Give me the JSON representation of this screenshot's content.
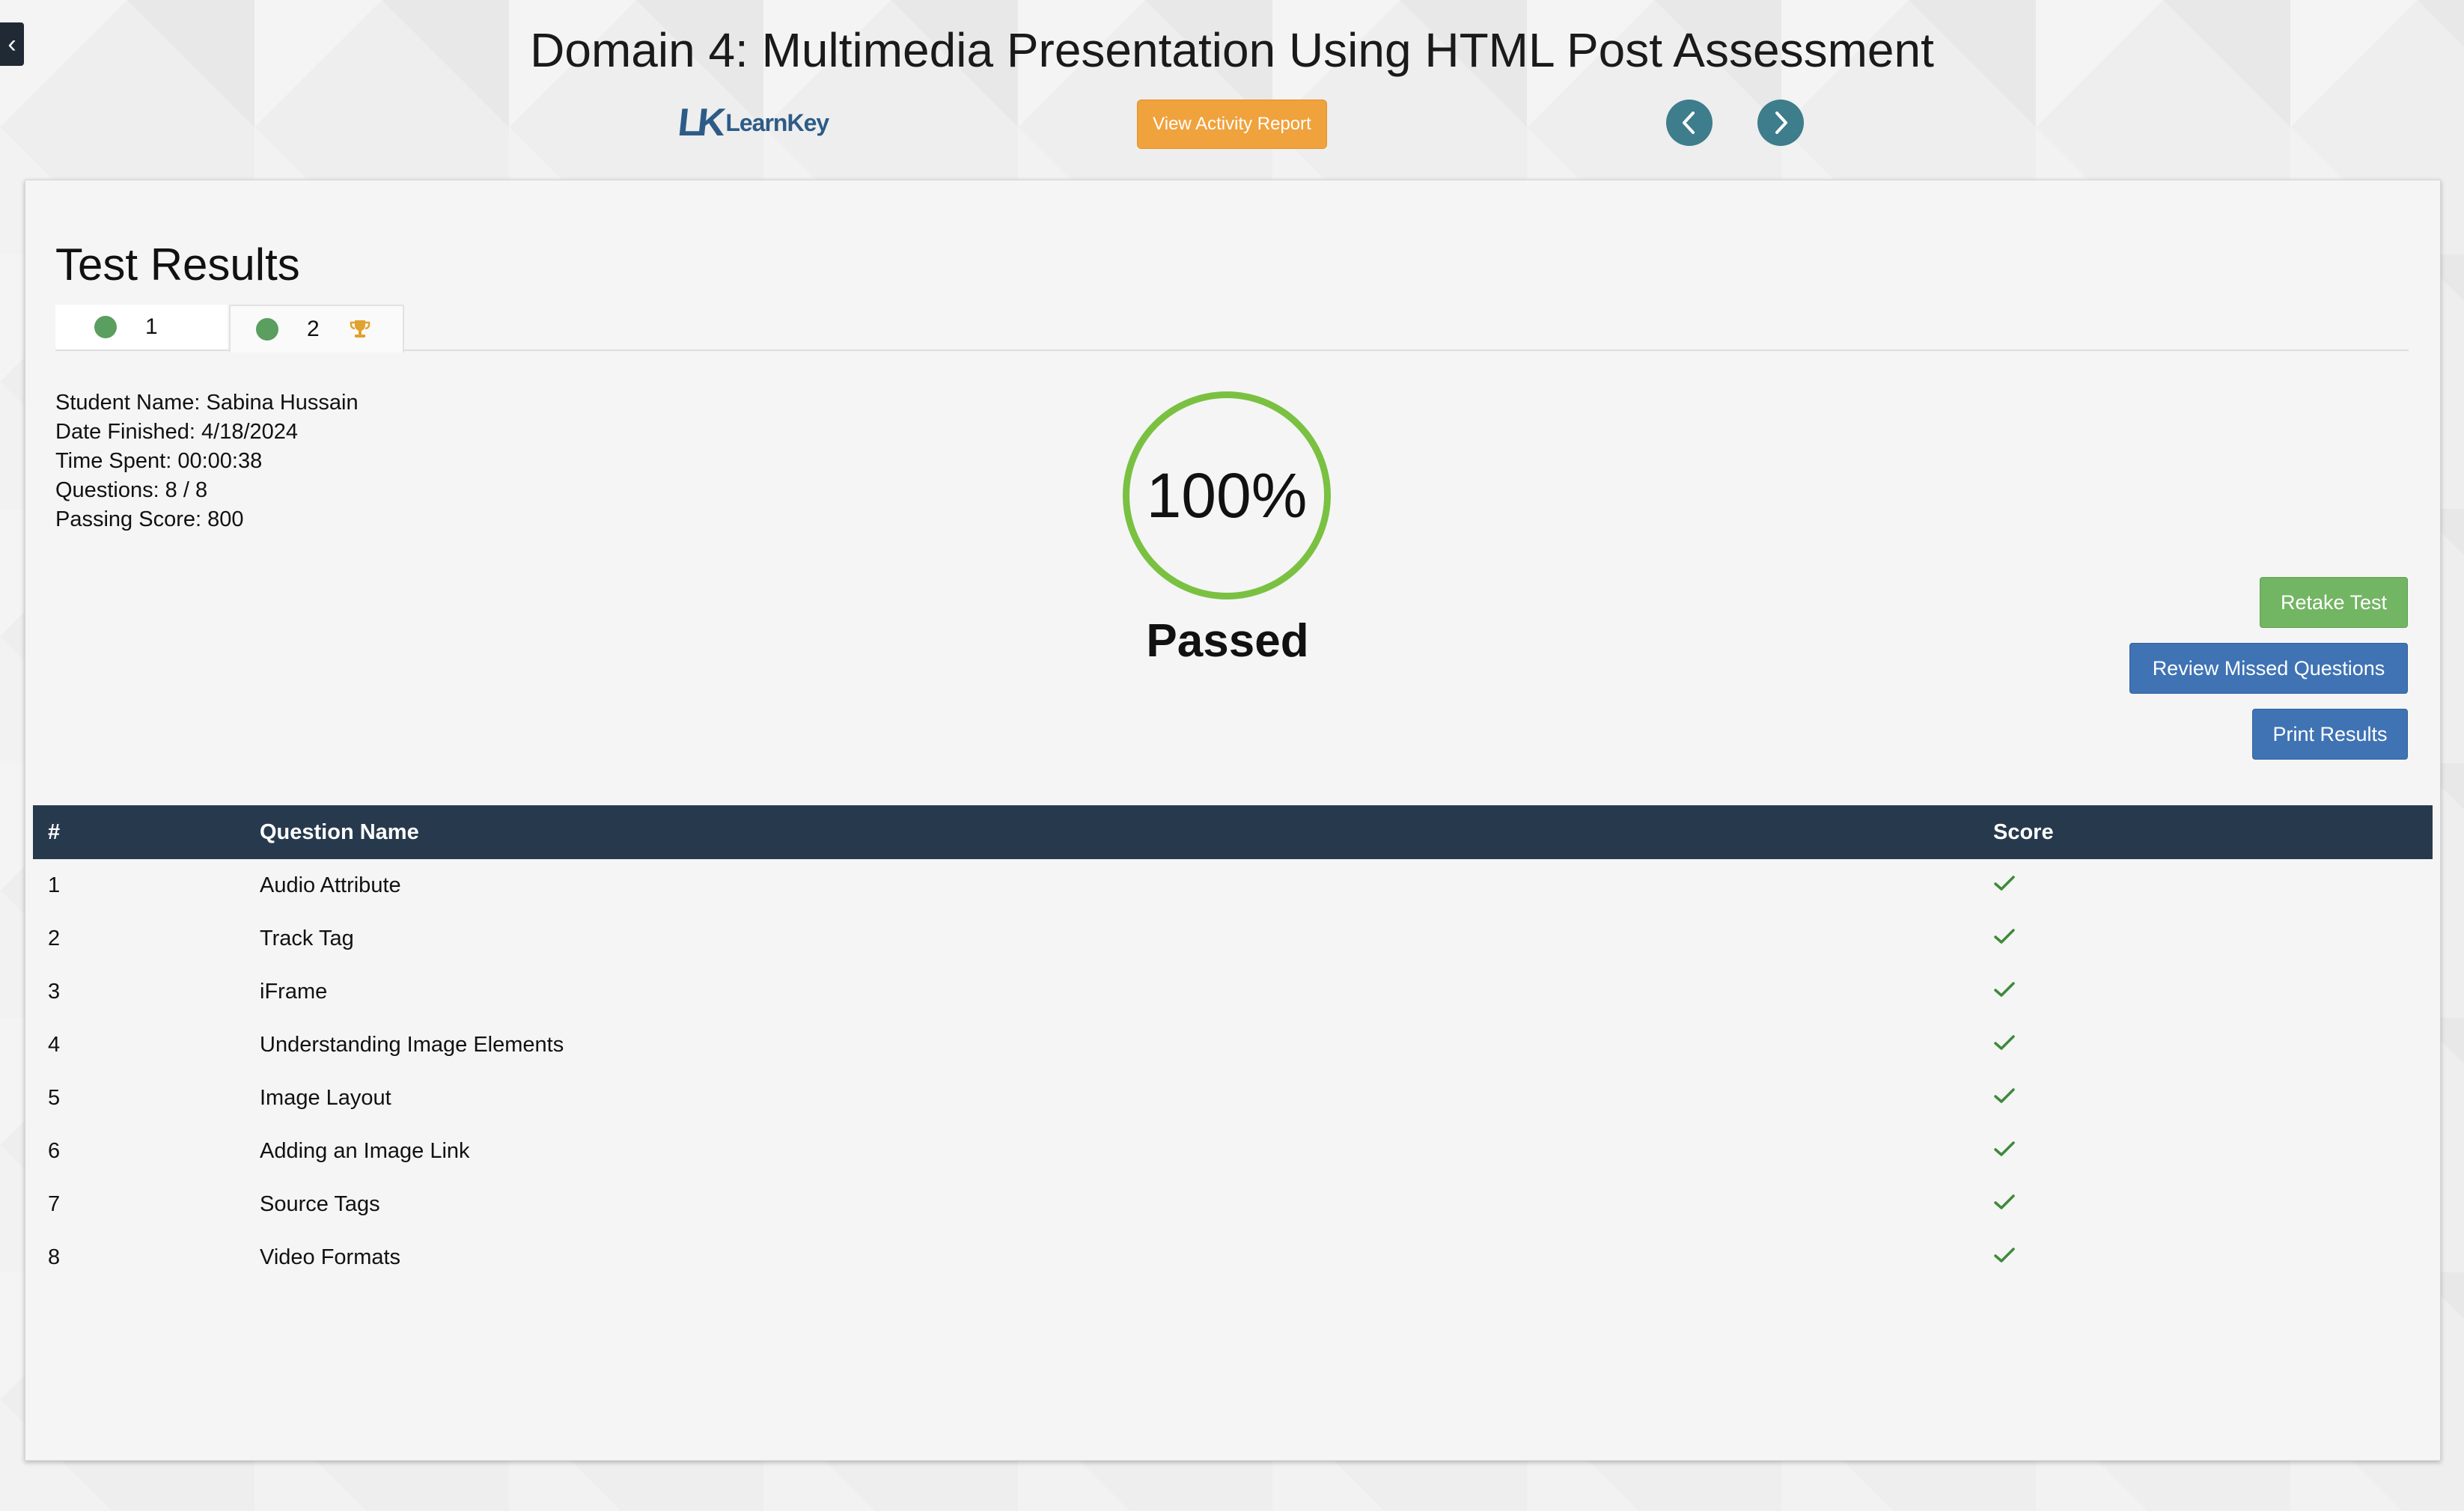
{
  "header": {
    "title": "Domain 4: Multimedia Presentation Using HTML Post Assessment",
    "logo_mark": "LK",
    "logo_text": "LearnKey",
    "activity_button": "View Activity Report"
  },
  "card": {
    "title": "Test Results",
    "tabs": [
      {
        "label": "1",
        "status": "passed"
      },
      {
        "label": "2",
        "status": "passed",
        "icon": "trophy-icon",
        "active": true
      }
    ],
    "info": {
      "student_name": "Student Name: Sabina Hussain",
      "date_finished": "Date Finished: 4/18/2024",
      "time_spent": "Time Spent: 00:00:38",
      "questions": "Questions: 8 / 8",
      "passing_score": "Passing Score: 800"
    },
    "score": "100%",
    "status": "Passed",
    "buttons": {
      "retake": "Retake Test",
      "review": "Review Missed Questions",
      "print": "Print Results"
    }
  },
  "table": {
    "headers": {
      "num": "#",
      "name": "Question Name",
      "score": "Score"
    },
    "rows": [
      {
        "num": "1",
        "name": "Audio Attribute",
        "correct": true
      },
      {
        "num": "2",
        "name": "Track Tag",
        "correct": true
      },
      {
        "num": "3",
        "name": "iFrame",
        "correct": true
      },
      {
        "num": "4",
        "name": "Understanding Image Elements",
        "correct": true
      },
      {
        "num": "5",
        "name": "Image Layout",
        "correct": true
      },
      {
        "num": "6",
        "name": "Adding an Image Link",
        "correct": true
      },
      {
        "num": "7",
        "name": "Source Tags",
        "correct": true
      },
      {
        "num": "8",
        "name": "Video Formats",
        "correct": true
      }
    ]
  },
  "colors": {
    "accent_orange": "#f0a23c",
    "nav_teal": "#3d7d8c",
    "header_navy": "#273a4d",
    "pass_green": "#7ac142",
    "button_blue": "#3f73b4",
    "button_green": "#72b563"
  }
}
